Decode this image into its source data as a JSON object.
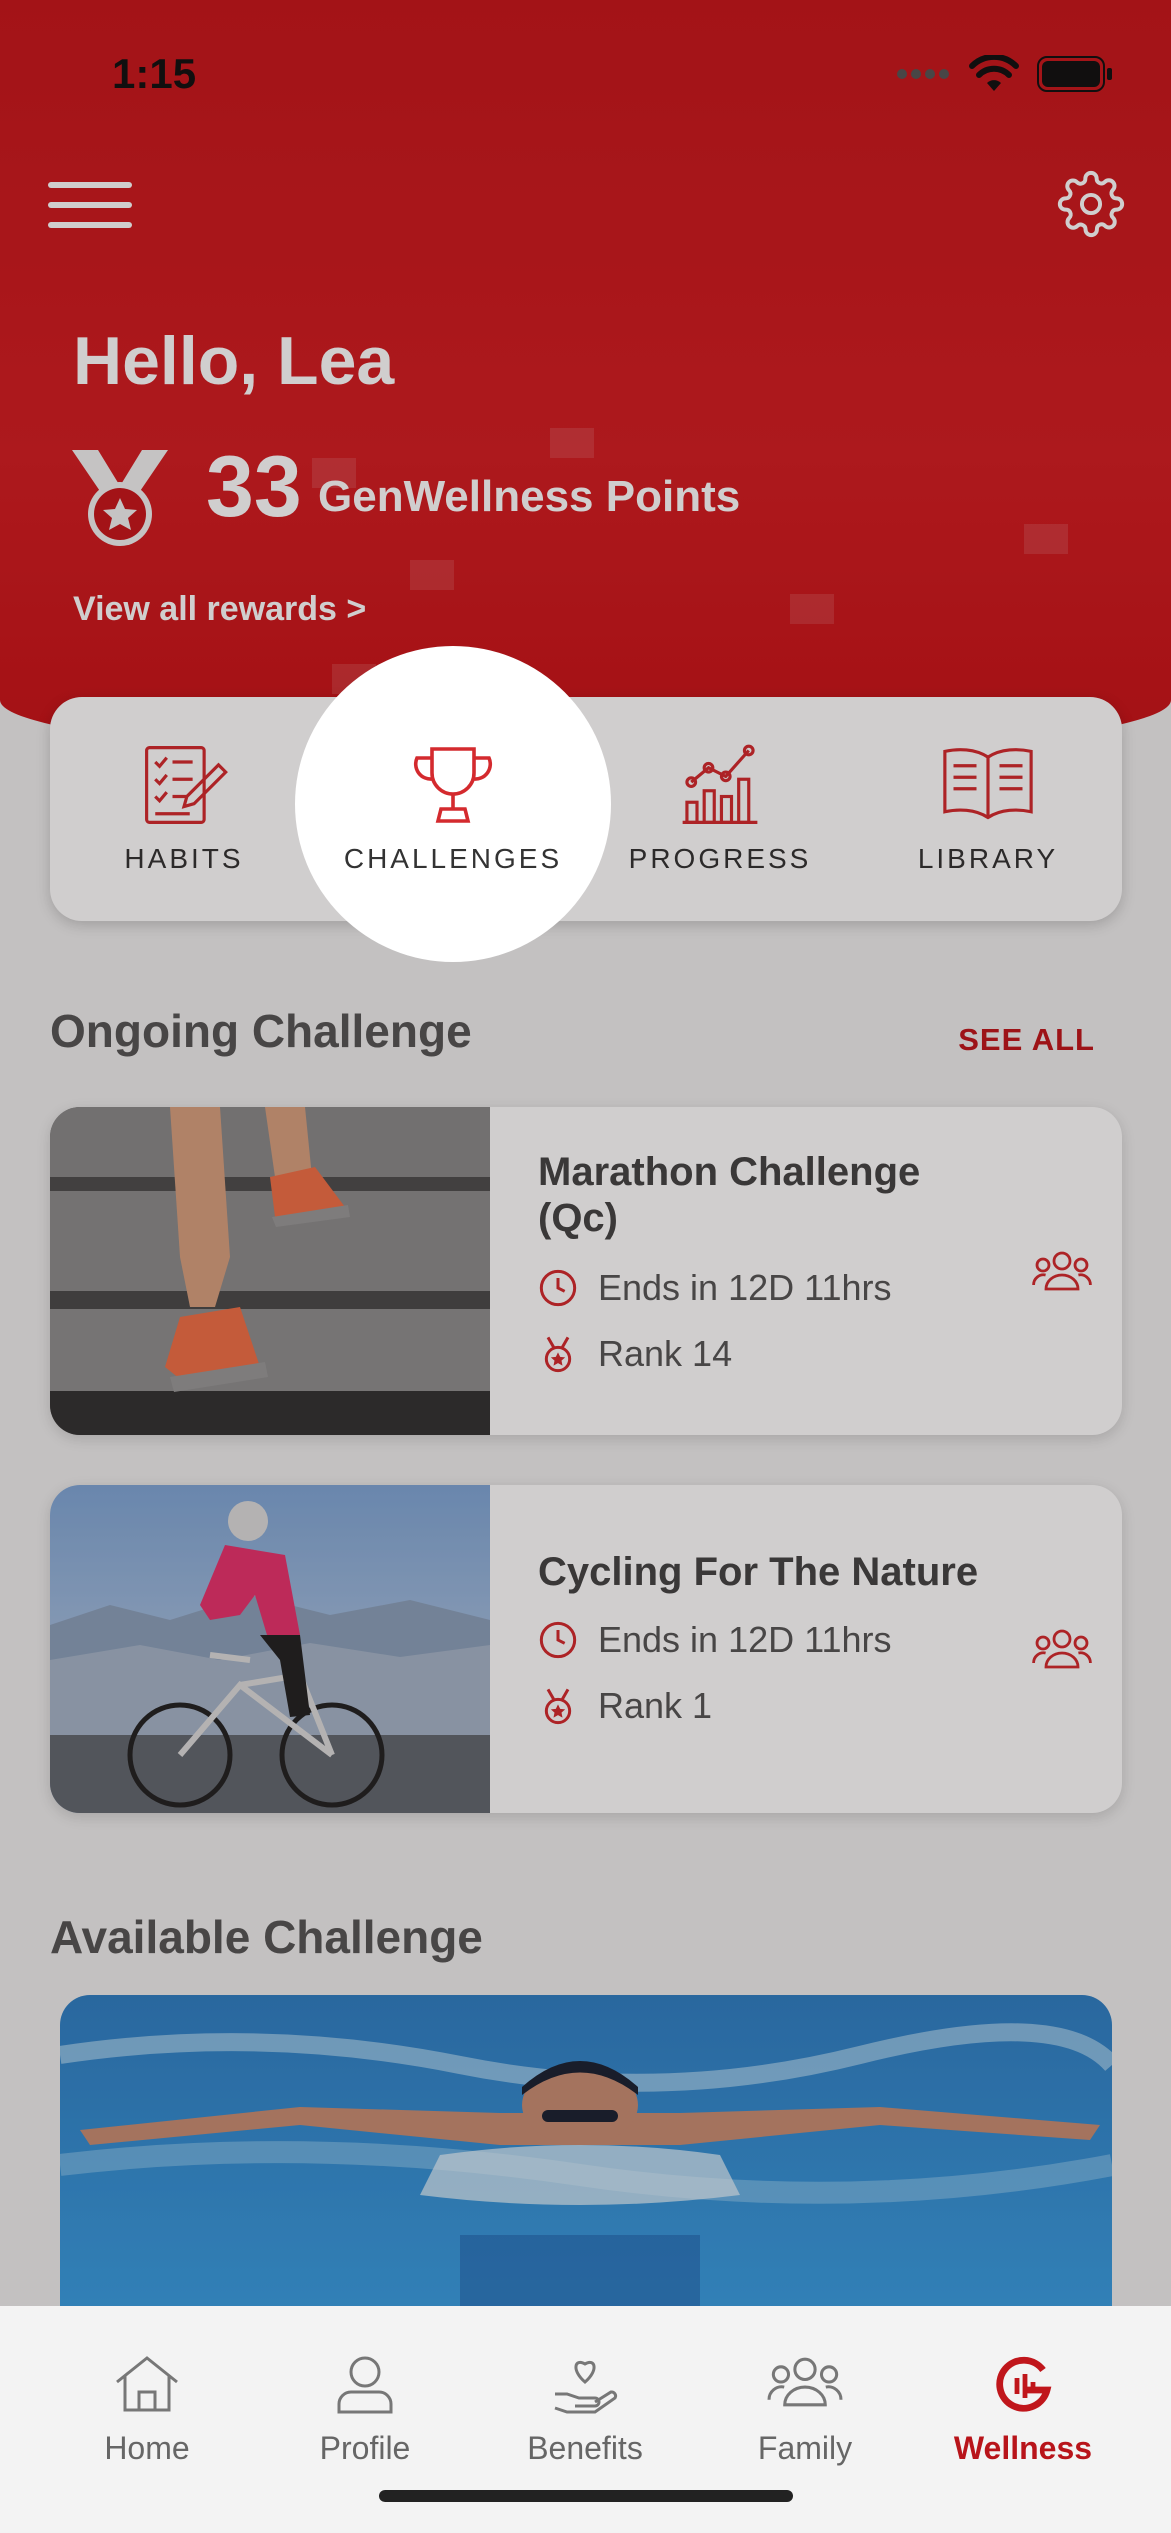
{
  "status_bar": {
    "time": "1:15"
  },
  "header": {
    "greeting": "Hello, Lea",
    "points_value": "33",
    "points_label": "GenWellness Points",
    "rewards_link": "View all rewards >"
  },
  "shortcuts": [
    {
      "label": "HABITS",
      "icon": "checklist-icon"
    },
    {
      "label": "CHALLENGES",
      "icon": "trophy-icon"
    },
    {
      "label": "PROGRESS",
      "icon": "chart-icon"
    },
    {
      "label": "LIBRARY",
      "icon": "book-icon"
    }
  ],
  "ongoing": {
    "title": "Ongoing Challenge",
    "see_all": "SEE ALL",
    "items": [
      {
        "title": "Marathon Challenge (Qc)",
        "ends": "Ends in 12D 11hrs",
        "rank": "Rank 14"
      },
      {
        "title": "Cycling For The Nature",
        "ends": "Ends in 12D 11hrs",
        "rank": "Rank 1"
      }
    ]
  },
  "available": {
    "title": "Available Challenge"
  },
  "tabbar": [
    {
      "label": "Home",
      "icon": "home-icon"
    },
    {
      "label": "Profile",
      "icon": "profile-icon"
    },
    {
      "label": "Benefits",
      "icon": "benefits-icon"
    },
    {
      "label": "Family",
      "icon": "family-icon"
    },
    {
      "label": "Wellness",
      "icon": "wellness-icon",
      "active": true
    }
  ],
  "colors": {
    "brand_red": "#c7161b",
    "accent_red": "#d42a2e",
    "background": "#efefef"
  }
}
